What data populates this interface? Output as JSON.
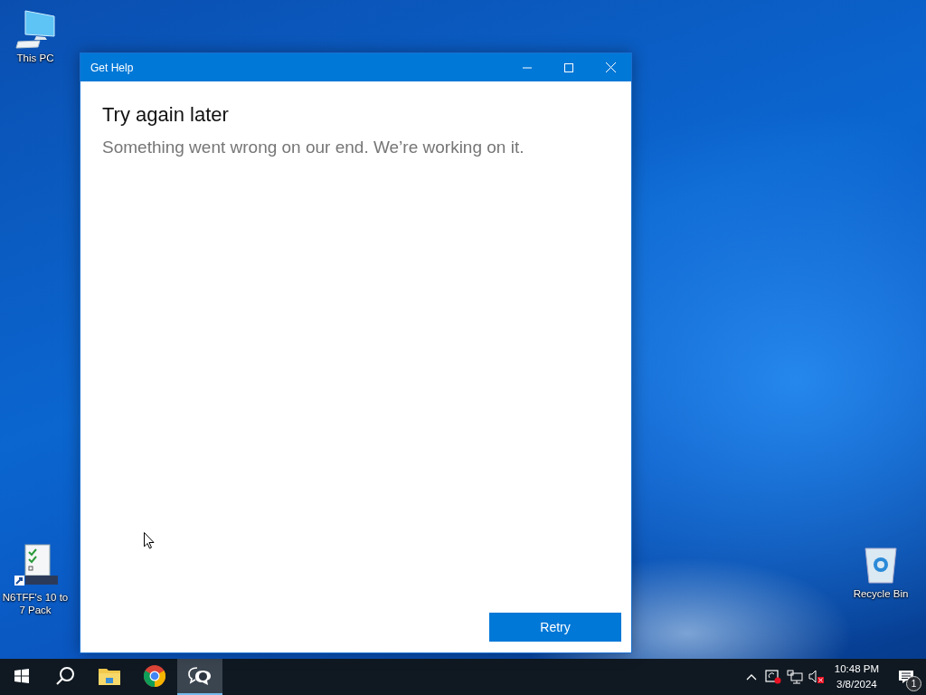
{
  "desktop_icons": [
    {
      "kind": "computer",
      "label": "This PC"
    },
    {
      "kind": "shortcut",
      "label": "N6TFF's 10 to 7 Pack"
    },
    {
      "kind": "recycle-bin",
      "label": "Recycle Bin"
    }
  ],
  "window": {
    "title": "Get Help",
    "heading": "Try again later",
    "message": "Something went wrong on our end. We’re working on it.",
    "button": "Retry"
  },
  "taskbar": {
    "apps": [
      {
        "kind": "start",
        "selected": false
      },
      {
        "kind": "search",
        "selected": false
      },
      {
        "kind": "explorer",
        "selected": false
      },
      {
        "kind": "chrome",
        "selected": false
      },
      {
        "kind": "get-help",
        "selected": true
      }
    ],
    "tray": [
      {
        "kind": "chevron"
      },
      {
        "kind": "sync-error"
      },
      {
        "kind": "network"
      },
      {
        "kind": "volume-muted"
      }
    ],
    "time": "10:48 PM",
    "date": "3/8/2024",
    "notification_count": "1"
  }
}
